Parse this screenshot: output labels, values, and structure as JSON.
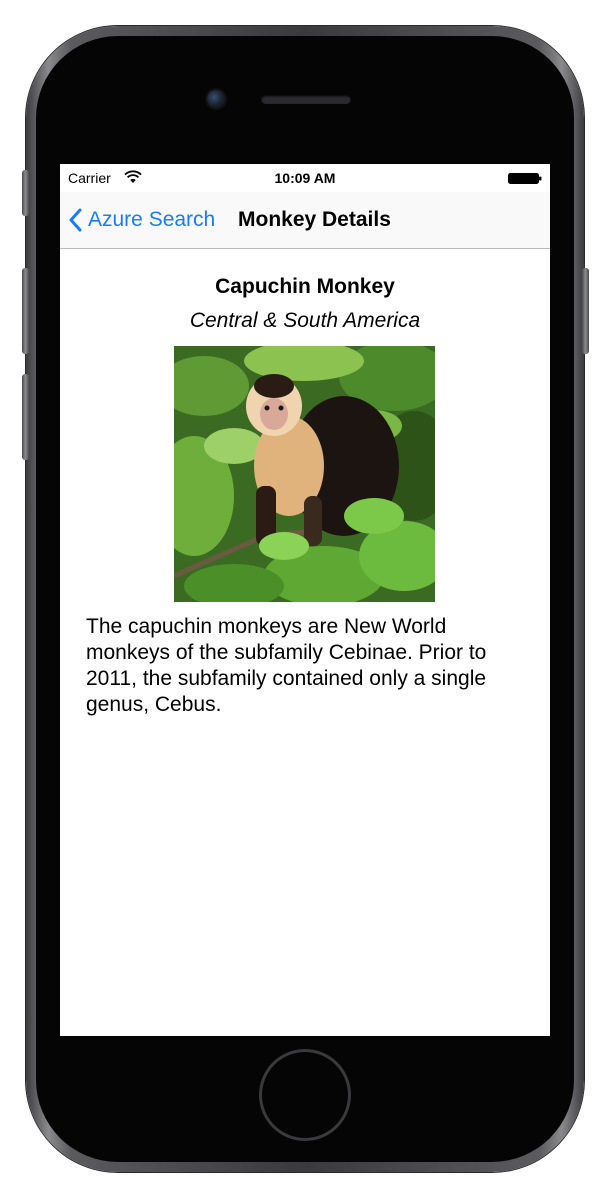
{
  "status_bar": {
    "carrier": "Carrier",
    "time": "10:09 AM",
    "wifi_icon": "wifi-icon",
    "battery_icon": "battery-icon"
  },
  "nav": {
    "back_label": "Azure Search",
    "back_icon": "chevron-left-icon",
    "title": "Monkey Details"
  },
  "monkey": {
    "name": "Capuchin Monkey",
    "location": "Central & South America",
    "photo": "capuchin-monkey-photo",
    "description": "The capuchin monkeys are New World monkeys of the subfamily Cebinae. Prior to 2011, the subfamily contained only a single genus, Cebus."
  },
  "colors": {
    "accent": "#1a7cf5",
    "background": "#ffffff",
    "phone_body": "#050505"
  }
}
